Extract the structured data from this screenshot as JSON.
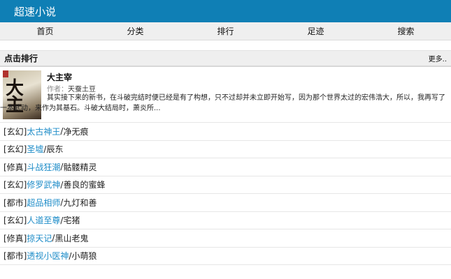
{
  "header": {
    "site_title": "超速小说"
  },
  "nav": {
    "items": [
      {
        "label": "首页"
      },
      {
        "label": "分类"
      },
      {
        "label": "排行"
      },
      {
        "label": "足迹"
      },
      {
        "label": "搜索"
      }
    ]
  },
  "ranking": {
    "title": "点击排行",
    "more_label": "更多..",
    "featured": {
      "title": "大主宰",
      "author_prefix": "作者：",
      "author": "天蚕土豆",
      "summary": "其实接下来的新书，在斗破完结时便已经是有了构想，只不过却并未立即开始写，因为那个世界太过的宏伟浩大，所以，我再写了一本武动，来作为其基石。斗破大结局时，萧炎所..."
    },
    "list": [
      {
        "category": "[玄幻]",
        "title": "太古神王",
        "author": "净无痕"
      },
      {
        "category": "[玄幻]",
        "title": "圣墟",
        "author": "辰东"
      },
      {
        "category": "[修真]",
        "title": "斗战狂潮",
        "author": "骷髅精灵"
      },
      {
        "category": "[玄幻]",
        "title": "修罗武神",
        "author": "善良的蜜蜂"
      },
      {
        "category": "[都市]",
        "title": "超品相师",
        "author": "九灯和善"
      },
      {
        "category": "[玄幻]",
        "title": "人道至尊",
        "author": "宅猪"
      },
      {
        "category": "[修真]",
        "title": "掠天记",
        "author": "黑山老鬼"
      },
      {
        "category": "[都市]",
        "title": "透视小医神",
        "author": "小萌狼"
      }
    ]
  }
}
